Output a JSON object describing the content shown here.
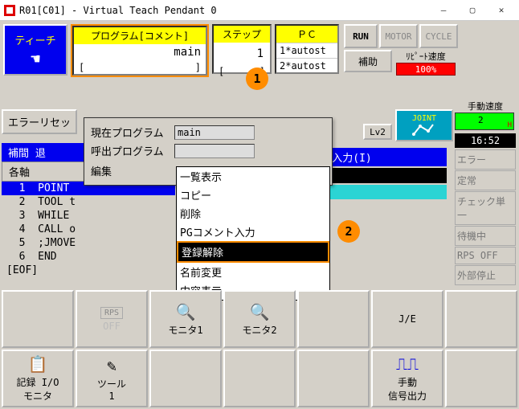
{
  "window": {
    "title": "R01[C01] - Virtual Teach Pendant 0"
  },
  "top": {
    "teach": "ティーチ",
    "program_hdr": "プログラム[コメント]",
    "program_val": "main",
    "program_ft_l": "[",
    "program_ft_r": "]",
    "step_hdr": "ステップ",
    "step_val": "1",
    "step_ft_l": "[",
    "step_ft_r": "]",
    "pc_hdr": "ＰＣ",
    "pc_rows": [
      "1*autost",
      "2*autost"
    ],
    "run": "RUN",
    "motor": "MOTOR",
    "cycle": "CYCLE",
    "aux": "補助",
    "repeat_lbl": "ﾘﾋﾟｰﾄ速度",
    "repeat_val": "100%"
  },
  "right": {
    "manual_lbl": "手動速度",
    "speed_val": "2",
    "clock": "16:52",
    "status": [
      "エラー",
      "定常",
      "チェック単一",
      "待機中",
      "RPS OFF",
      "外部停止"
    ],
    "joint": "JOINT",
    "lv2": "Lv2"
  },
  "errtab": "エラーリセッ",
  "prog": {
    "tab1": "補間 退",
    "tab2": "各軸",
    "lines": [
      {
        "n": "1",
        "t": "POINT",
        "cls": "pt"
      },
      {
        "n": "2",
        "t": "TOOL t"
      },
      {
        "n": "3",
        "t": "WHILE"
      },
      {
        "n": "4",
        "t": "CALL o"
      },
      {
        "n": "5",
        "t": ";JMOVE"
      },
      {
        "n": "6",
        "t": "END"
      }
    ],
    "eof": "[EOF]"
  },
  "input": {
    "label": "入力(I)",
    "bracket": "]["
  },
  "popup": {
    "cur_prog_lbl": "現在プログラム",
    "cur_prog_val": "main",
    "call_prog_lbl": "呼出プログラム",
    "edit_lbl": "編集",
    "menu": [
      "一覧表示",
      "コピー",
      "削除",
      "PGコメント入力",
      "登録解除",
      "名前変更",
      "内容表示"
    ],
    "selected_index": 4
  },
  "callouts": {
    "one": "1",
    "two": "2"
  },
  "bottom": {
    "rps": "RPS",
    "off": "OFF",
    "mon1": "モニタ1",
    "mon2": "モニタ2",
    "je": "J/E",
    "rec": "記録 I/O\nモニタ",
    "tool": "ツール\n1",
    "sig": "手動\n信号出力"
  }
}
